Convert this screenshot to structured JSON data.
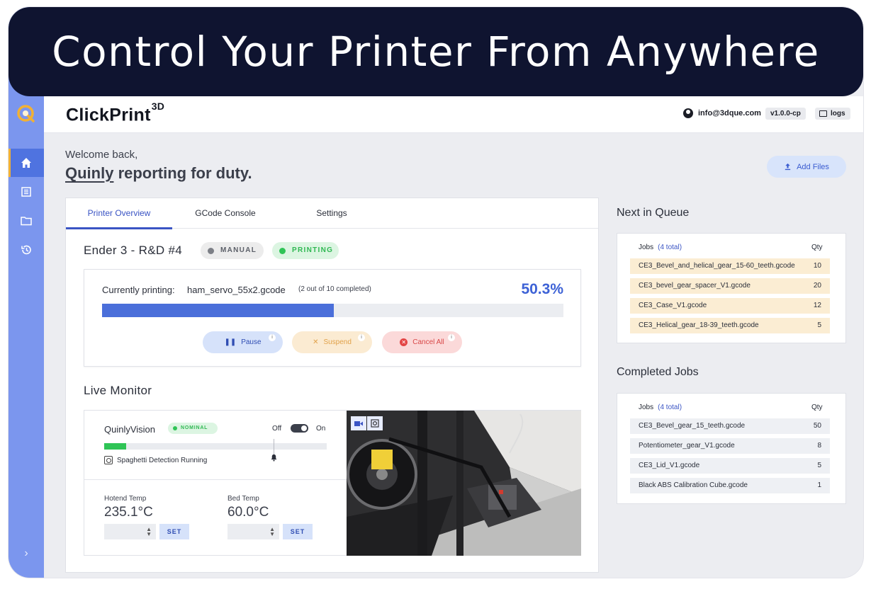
{
  "banner": {
    "title": "Control Your Printer From Anywhere"
  },
  "brand": {
    "name": "ClickPrint",
    "sup": "3D"
  },
  "header": {
    "email": "info@3dque.com",
    "version": "v1.0.0-cp",
    "logs_label": "logs"
  },
  "sidebar": {
    "items": [
      {
        "name": "home",
        "icon": "home-icon",
        "active": true
      },
      {
        "name": "list",
        "icon": "list-icon",
        "active": false
      },
      {
        "name": "files",
        "icon": "folder-icon",
        "active": false
      },
      {
        "name": "history",
        "icon": "history-icon",
        "active": false
      }
    ],
    "expand_label": "›"
  },
  "welcome": {
    "greeting": "Welcome back,",
    "name": "Quinly",
    "rest": " reporting for duty."
  },
  "add_files_label": "Add Files",
  "tabs": [
    {
      "label": "Printer Overview",
      "active": true
    },
    {
      "label": "GCode Console",
      "active": false
    },
    {
      "label": "Settings",
      "active": false
    }
  ],
  "printer": {
    "name": "Ender 3 - R&D #4",
    "mode_badge": "MANUAL",
    "state_badge": "PRINTING",
    "current_label": "Currently printing:",
    "current_file": "ham_servo_55x2.gcode",
    "completed_note": "(2 out of 10 completed)",
    "progress_text": "50.3%",
    "progress_value": 50.3,
    "actions": {
      "pause": "Pause",
      "suspend": "Suspend",
      "cancel": "Cancel All",
      "info": "i"
    }
  },
  "live_monitor": {
    "title": "Live Monitor",
    "vision_title": "QuinlyVision",
    "vision_badge": "NOMINAL",
    "toggle_off": "Off",
    "toggle_on": "On",
    "toggle_state": "on",
    "vision_level": 0.1,
    "vision_status": "Spaghetti Detection Running",
    "hotend": {
      "label": "Hotend Temp",
      "value": "235.1°C"
    },
    "bed": {
      "label": "Bed Temp",
      "value": "60.0°C"
    },
    "set_label": "SET"
  },
  "queue": {
    "heading": "Next in Queue",
    "jobs_label": "Jobs",
    "total": "(4 total)",
    "qty_label": "Qty",
    "rows": [
      {
        "name": "CE3_Bevel_and_helical_gear_15-60_teeth.gcode",
        "qty": "10"
      },
      {
        "name": "CE3_bevel_gear_spacer_V1.gcode",
        "qty": "20"
      },
      {
        "name": "CE3_Case_V1.gcode",
        "qty": "12"
      },
      {
        "name": "CE3_Helical_gear_18-39_teeth.gcode",
        "qty": "5"
      }
    ]
  },
  "completed": {
    "heading": "Completed Jobs",
    "jobs_label": "Jobs",
    "total": "(4 total)",
    "qty_label": "Qty",
    "rows": [
      {
        "name": "CE3_Bevel_gear_15_teeth.gcode",
        "qty": "50"
      },
      {
        "name": "Potentiometer_gear_V1.gcode",
        "qty": "8"
      },
      {
        "name": "CE3_Lid_V1.gcode",
        "qty": "5"
      },
      {
        "name": "Black ABS Calibration Cube.gcode",
        "qty": "1"
      }
    ]
  },
  "colors": {
    "accent": "#3a54c4",
    "banner": "#0f1430",
    "sidebar": "#7b96ee",
    "success": "#2fc456",
    "warning": "#e1a24a",
    "danger": "#d94848"
  }
}
